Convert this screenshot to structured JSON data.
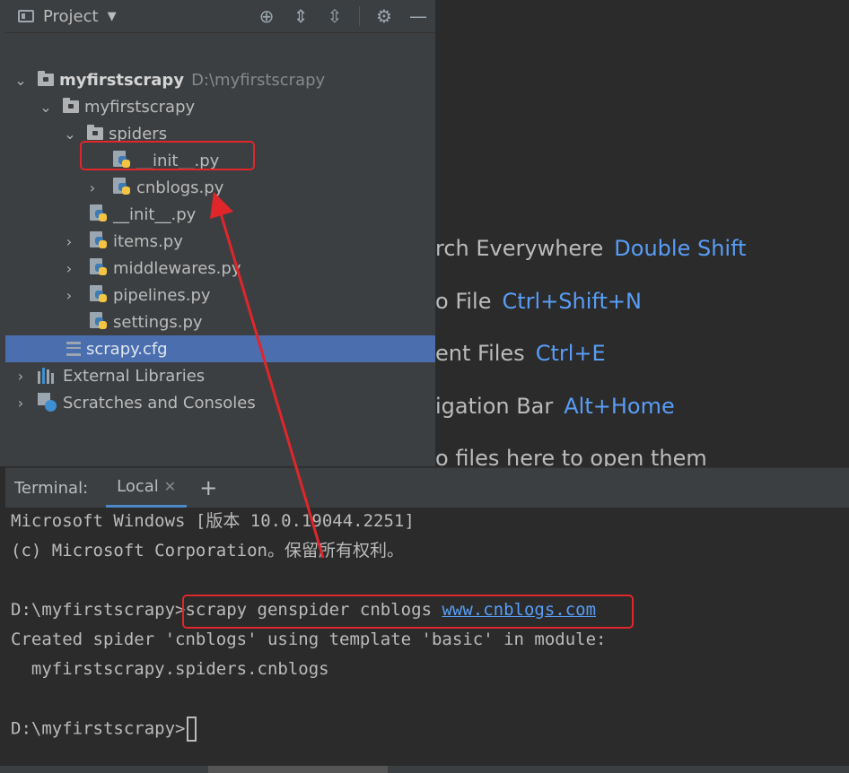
{
  "project_panel": {
    "title": "Project",
    "tree": [
      {
        "label": "myfirstscrapy",
        "path": "D:\\myfirstscrapy"
      },
      {
        "label": "myfirstscrapy"
      },
      {
        "label": "spiders"
      },
      {
        "label": "__init__.py"
      },
      {
        "label": "cnblogs.py"
      },
      {
        "label": "__init__.py"
      },
      {
        "label": "items.py"
      },
      {
        "label": "middlewares.py"
      },
      {
        "label": "pipelines.py"
      },
      {
        "label": "settings.py"
      },
      {
        "label": "scrapy.cfg"
      },
      {
        "label": "External Libraries"
      },
      {
        "label": "Scratches and Consoles"
      }
    ]
  },
  "editor_hints": [
    {
      "text": "rch Everywhere",
      "key": "Double Shift"
    },
    {
      "text": "o File",
      "key": "Ctrl+Shift+N"
    },
    {
      "text": "ent Files",
      "key": "Ctrl+E"
    },
    {
      "text": "igation Bar",
      "key": "Alt+Home"
    },
    {
      "text": "o files here to open them",
      "key": ""
    }
  ],
  "terminal": {
    "label": "Terminal:",
    "tab": "Local",
    "lines": {
      "l1": "Microsoft Windows [版本 10.0.19044.2251]",
      "l2": "(c) Microsoft Corporation。保留所有权利。",
      "l3_prompt": "D:\\myfirstscrapy>",
      "l3_cmd": "scrapy genspider cnblogs ",
      "l3_link": "www.cnblogs.com",
      "l4": "Created spider 'cnblogs' using template 'basic' in module:",
      "l5": "  myfirstscrapy.spiders.cnblogs",
      "l6_prompt": "D:\\myfirstscrapy>"
    }
  },
  "colors": {
    "accent": "#4b6eaf",
    "link": "#589df6",
    "annotation": "#e0262b"
  }
}
